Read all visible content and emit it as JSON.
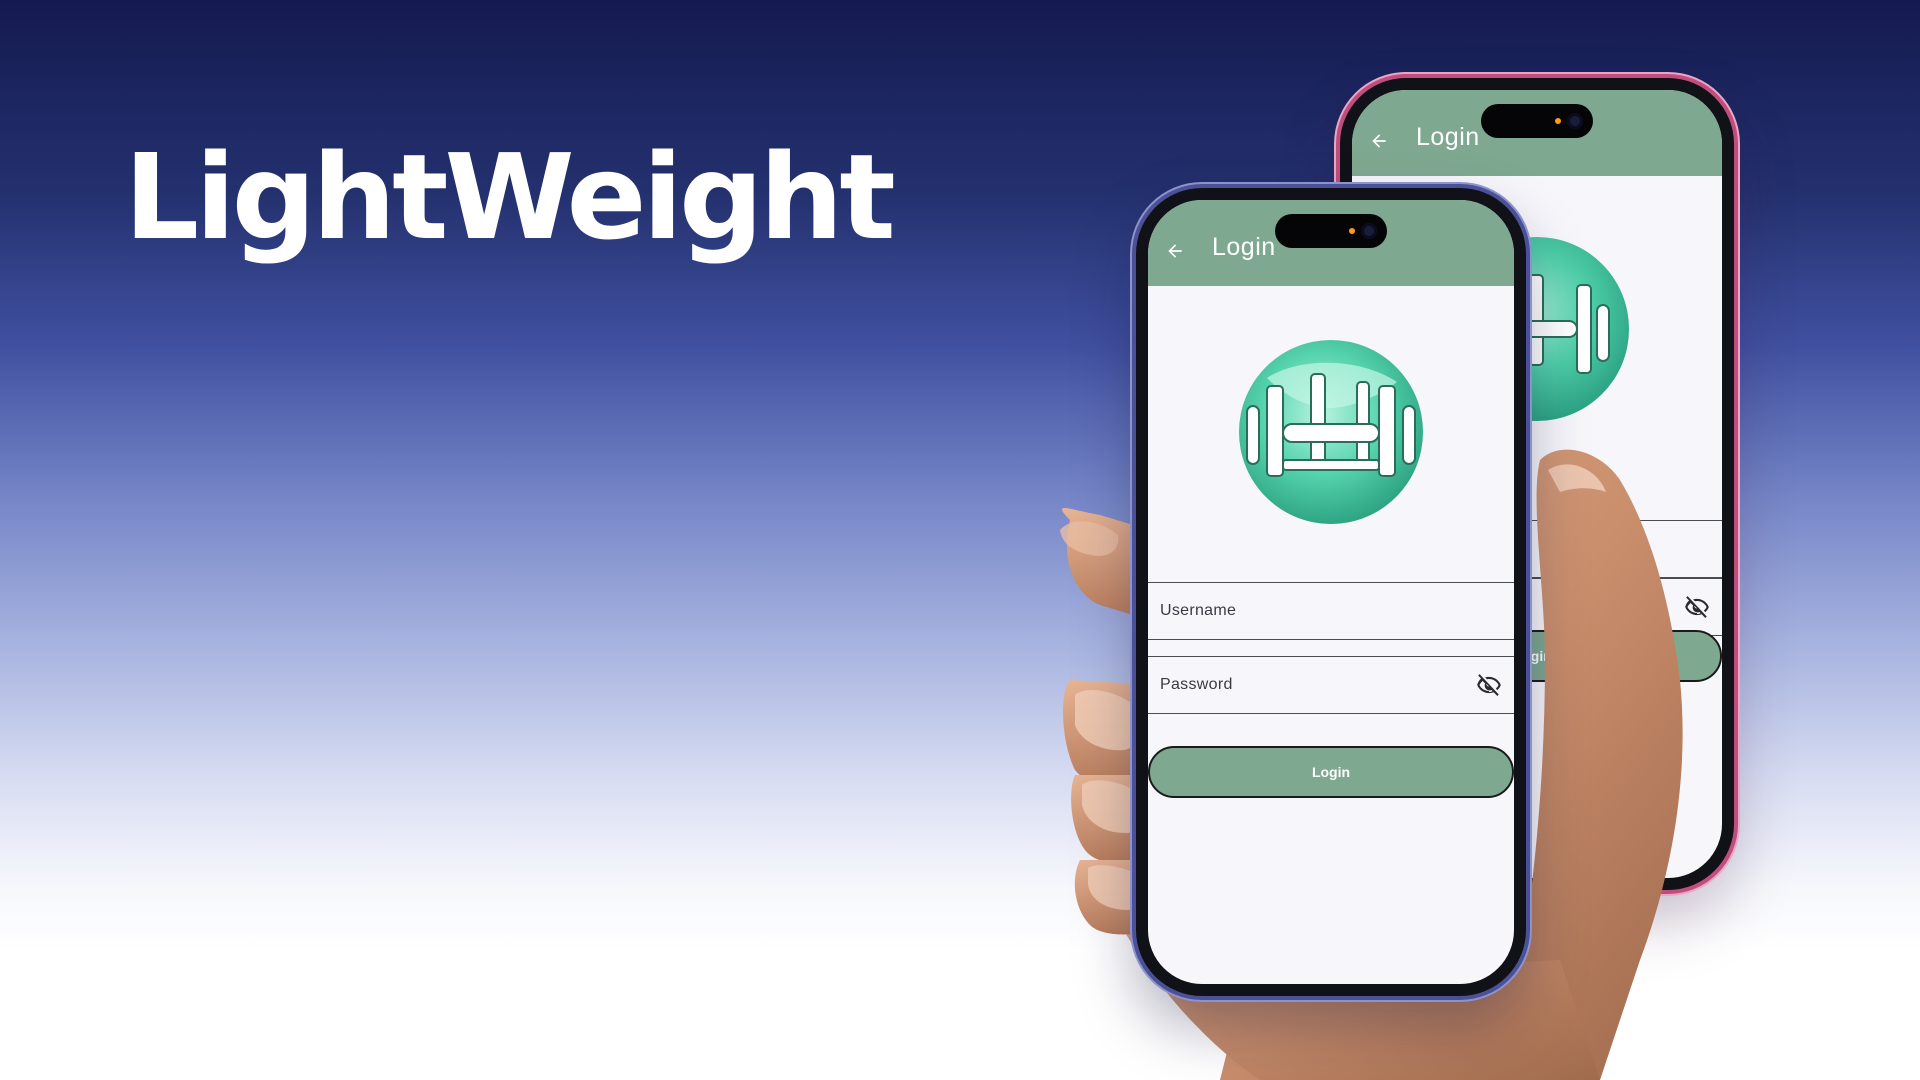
{
  "brand": {
    "title": "LightWeight"
  },
  "phones": {
    "front": {
      "appbar_title": "Login",
      "username_label": "Username",
      "password_label": "Password",
      "login_button": "Login"
    },
    "back": {
      "appbar_title": "Login",
      "login_button_partial": "ogin"
    }
  },
  "icons": {
    "back": "arrow-back-icon",
    "visibility": "eye-off-icon",
    "logo": "dumbbell-logo-icon"
  },
  "colors": {
    "accent": "#7fa891",
    "background_top": "#141a50",
    "background_bottom": "#ffffff",
    "logo_teal": "#5fd6b4"
  }
}
